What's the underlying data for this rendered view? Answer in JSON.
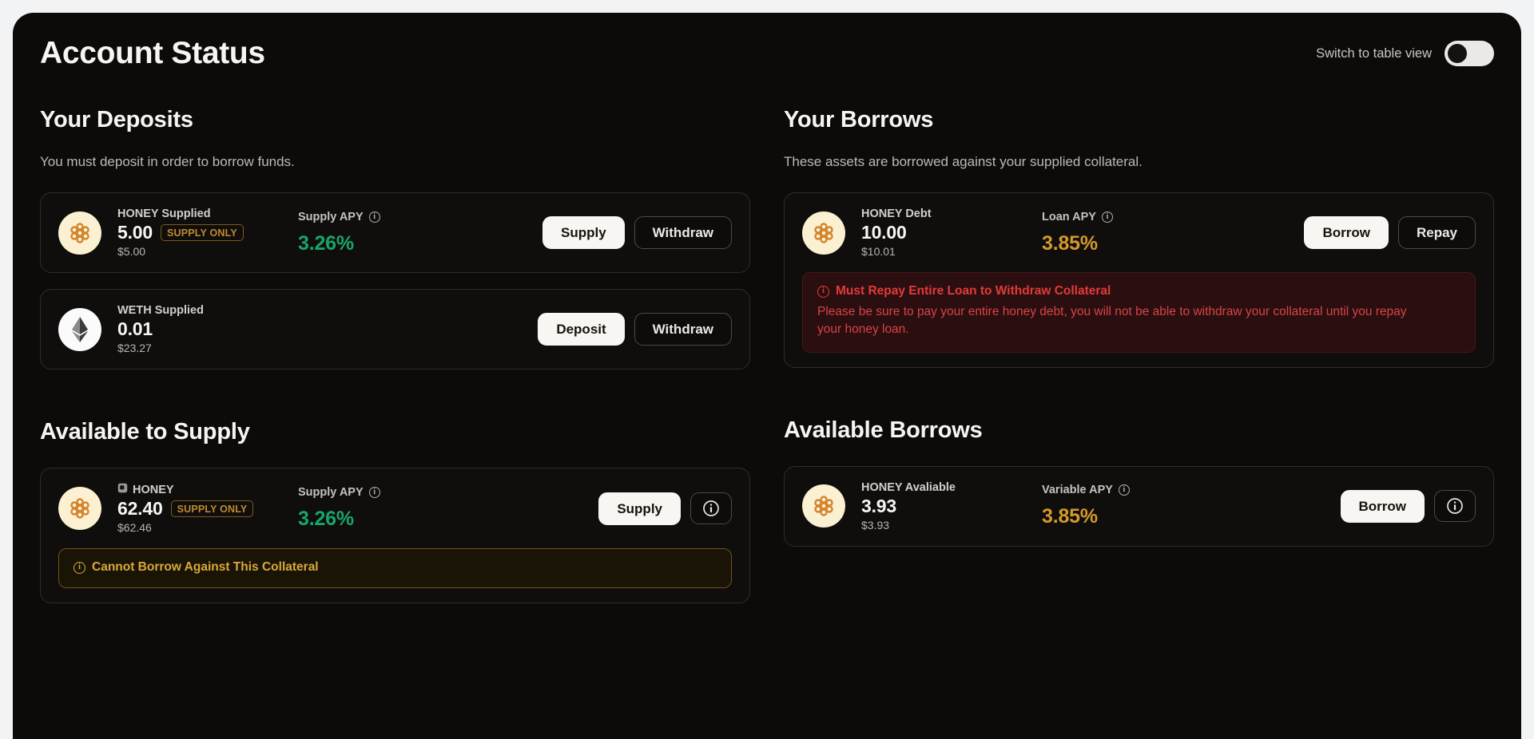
{
  "header": {
    "title": "Account Status",
    "toggle_label": "Switch to table view",
    "toggle_state": "off"
  },
  "colors": {
    "surface": "#0d0b09",
    "card_border": "#302c27",
    "apy_supply": "#17a66a",
    "apy_borrow": "#d49a2a",
    "badge": "#c08a2e",
    "alert_danger": "#e23b3b",
    "alert_warn": "#d9a93a",
    "primary_button_bg": "#f7f6f3"
  },
  "sections": {
    "deposits": {
      "title": "Your Deposits",
      "desc": "You must deposit in order to borrow funds.",
      "rows": [
        {
          "icon": "honey-coin-icon",
          "label": "HONEY Supplied",
          "amount": "5.00",
          "badge": "SUPPLY ONLY",
          "usd": "$5.00",
          "apy_label": "Supply APY",
          "apy_value": "3.26%",
          "apy_tone": "green",
          "buttons": [
            "Supply",
            "Withdraw"
          ]
        },
        {
          "icon": "weth-coin-icon",
          "label": "WETH Supplied",
          "amount": "0.01",
          "badge": "",
          "usd": "$23.27",
          "apy_label": "",
          "apy_value": "",
          "apy_tone": "",
          "buttons": [
            "Deposit",
            "Withdraw"
          ]
        }
      ]
    },
    "borrows": {
      "title": "Your Borrows",
      "desc": "These assets are borrowed against your supplied collateral.",
      "rows": [
        {
          "icon": "honey-coin-icon",
          "label": "HONEY Debt",
          "amount": "10.00",
          "badge": "",
          "usd": "$10.01",
          "apy_label": "Loan APY",
          "apy_value": "3.85%",
          "apy_tone": "gold",
          "buttons": [
            "Borrow",
            "Repay"
          ]
        }
      ],
      "alert": {
        "kind": "danger",
        "title": "Must Repay Entire Loan to Withdraw Collateral",
        "body": "Please be sure to pay your entire honey debt, you will not be able to withdraw your collateral until you repay your honey loan."
      }
    },
    "available_supply": {
      "title": "Available to Supply",
      "rows": [
        {
          "icon": "honey-coin-icon",
          "has_copy_icon": true,
          "label": "HONEY",
          "amount": "62.40",
          "badge": "SUPPLY ONLY",
          "usd": "$62.46",
          "apy_label": "Supply APY",
          "apy_value": "3.26%",
          "apy_tone": "green",
          "buttons": [
            "Supply"
          ],
          "info_button": "info-icon"
        }
      ],
      "alert": {
        "kind": "warn",
        "title": "Cannot Borrow Against This Collateral",
        "body": ""
      }
    },
    "available_borrows": {
      "title": "Available Borrows",
      "rows": [
        {
          "icon": "honey-coin-icon",
          "label": "HONEY Avaliable",
          "amount": "3.93",
          "badge": "",
          "usd": "$3.93",
          "apy_label": "Variable APY",
          "apy_value": "3.85%",
          "apy_tone": "gold",
          "buttons": [
            "Borrow"
          ],
          "info_button": "info-icon"
        }
      ]
    }
  }
}
